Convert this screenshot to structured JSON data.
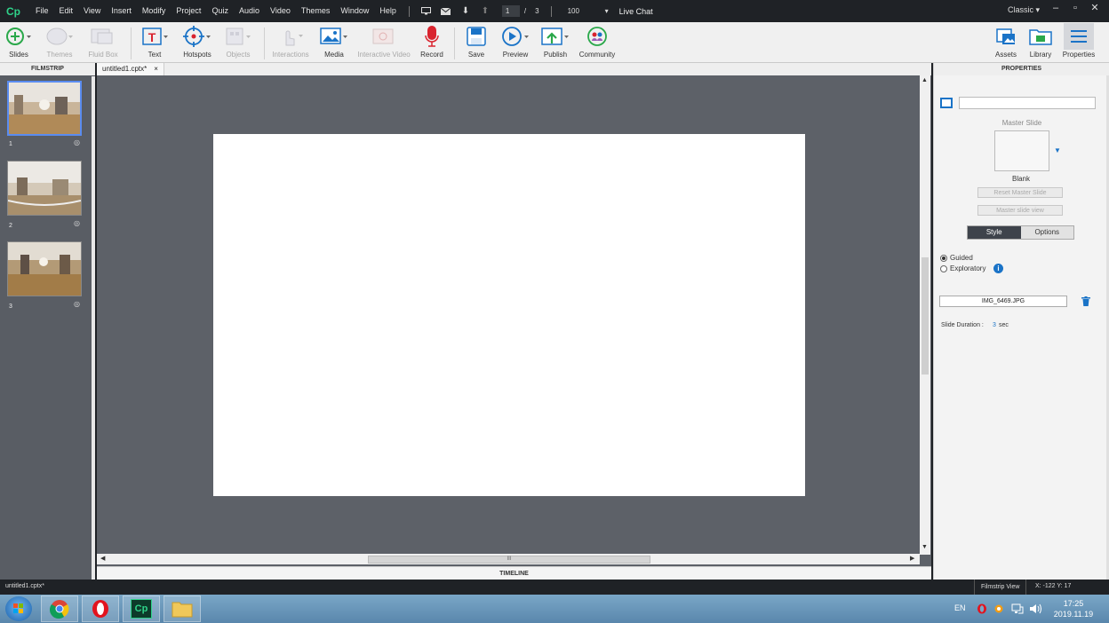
{
  "menubar": {
    "app_logo": "Cp",
    "items": [
      "File",
      "Edit",
      "View",
      "Insert",
      "Modify",
      "Project",
      "Quiz",
      "Audio",
      "Video",
      "Themes",
      "Window",
      "Help"
    ],
    "current_slide": "1",
    "slide_separator": "/",
    "total_slides": "3",
    "zoom": "100",
    "live_chat": "Live Chat",
    "workspace": "Classic"
  },
  "toolbar": {
    "slides": "Slides",
    "themes": "Themes",
    "fluid_box": "Fluid Box",
    "text": "Text",
    "hotspots": "Hotspots",
    "objects": "Objects",
    "interactions": "Interactions",
    "media": "Media",
    "interactive_video": "Interactive Video",
    "record": "Record",
    "save": "Save",
    "preview": "Preview",
    "publish": "Publish",
    "community": "Community",
    "assets": "Assets",
    "library": "Library",
    "properties": "Properties"
  },
  "filmstrip": {
    "title": "FILMSTRIP",
    "slides": [
      {
        "number": "1",
        "selected": true
      },
      {
        "number": "2",
        "selected": false
      },
      {
        "number": "3",
        "selected": false
      }
    ]
  },
  "document": {
    "tab_name": "untitled1.cptx*",
    "tab_close": "×",
    "timeline_label": "TIMELINE",
    "hscroll_grip": "III"
  },
  "properties": {
    "title": "PROPERTIES",
    "master_slide_label": "Master Slide",
    "master_slide_name": "Blank",
    "reset_master_slide": "Reset Master Slide",
    "master_slide_view": "Master slide view",
    "tab_style": "Style",
    "tab_options": "Options",
    "mode_guided": "Guided",
    "mode_exploratory": "Exploratory",
    "selected_mode": "Guided",
    "image_name": "IMG_6469.JPG",
    "slide_duration_label": "Slide Duration :",
    "slide_duration_value": "3",
    "slide_duration_unit": "sec"
  },
  "statusbar": {
    "file": "untitled1.cptx*",
    "view": "Filmstrip View",
    "coords": "X: -122 Y: 17"
  },
  "taskbar": {
    "language": "EN",
    "time": "17:25",
    "date": "2019.11.19"
  },
  "colors": {
    "accent": "#1a73c7",
    "dark_chrome": "#1f2226",
    "stage_bg": "#5d6168",
    "record_red": "#d9232e"
  }
}
